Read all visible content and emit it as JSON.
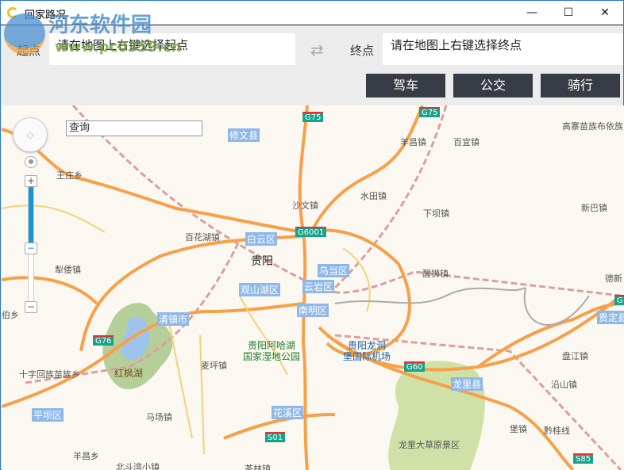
{
  "window": {
    "title": "回家路况",
    "minimize": "—",
    "maximize": "☐",
    "close": "✕"
  },
  "watermark": {
    "name": "河东软件园",
    "url": "www.pc0359.cn"
  },
  "route": {
    "start_label": "起点",
    "start_value": "请在地图上右键选择起点",
    "end_label": "终点",
    "end_value": "请在地图上右键选择终点",
    "swap_icon": "⇄"
  },
  "modes": {
    "drive": "驾车",
    "bus": "公交",
    "ride": "骑行"
  },
  "map": {
    "search_placeholder": "查询",
    "zoom_in": "+",
    "zoom_out": "−",
    "city": "贵阳",
    "places": [
      "修文县",
      "羊昌镇",
      "百宜镇",
      "高寨苗族布依族",
      "王庄乡",
      "沙文镇",
      "水田镇",
      "下坝镇",
      "新巴镇",
      "百花湖镇",
      "犁倭镇",
      "醒狮镇",
      "德新",
      "伯乡",
      "十字回族苗族乡",
      "麦坪镇",
      "马场镇",
      "羊昌乡",
      "北斗湾小镇",
      "盘江镇",
      "沿山镇",
      "黔桂线",
      "茶林镇",
      "龙里大草原景区",
      "堡镇"
    ],
    "districts": [
      "修文县",
      "白云区",
      "乌当区",
      "观山湖区",
      "云岩区",
      "南明区",
      "清镇市",
      "平坝区",
      "花溪区",
      "龙里县",
      "贵定县"
    ],
    "highways": [
      "G75",
      "G75",
      "G6001",
      "G76",
      "G60",
      "S01",
      "S85",
      "G"
    ],
    "pois": [
      "贵阳阿哈湖\n国家湿地公园",
      "贵阳龙洞\n堡国际机场",
      "红枫湖"
    ]
  }
}
